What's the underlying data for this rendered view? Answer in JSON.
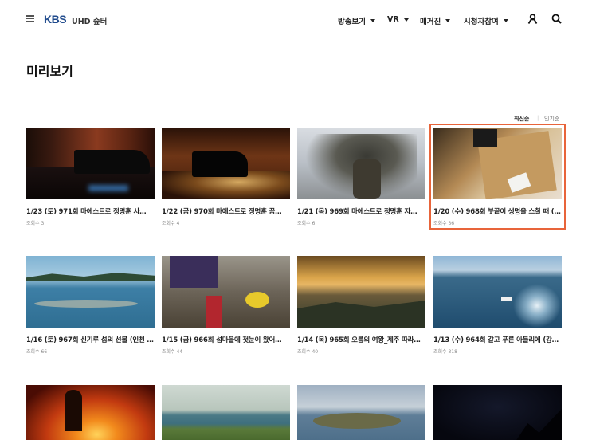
{
  "header": {
    "logo": "KBS",
    "subbrand": "UHD 숲터",
    "nav": [
      {
        "label": "방송보기"
      },
      {
        "label": "VR"
      },
      {
        "label": "매거진"
      },
      {
        "label": "시청자참여"
      }
    ],
    "icons": [
      "menu-icon",
      "user-icon",
      "search-icon"
    ]
  },
  "page": {
    "title": "미리보기"
  },
  "sort": {
    "latest": "최신순",
    "separator": "|",
    "popular": "인기순"
  },
  "accent_color": "#e8643a",
  "brand_color": "#1f4a8c",
  "videos": [
    {
      "title": "1/23 (토) 971회 마에스트로 정명훈 사…",
      "views": "조회수 3"
    },
    {
      "title": "1/22 (금) 970회 마에스트로 정명훈 꿈…",
      "views": "조회수 4"
    },
    {
      "title": "1/21 (목) 969회 마에스트로 정명훈 자…",
      "views": "조회수 6"
    },
    {
      "title": "1/20 (수) 968회 붓끝이 생명을 스칠 때 (…",
      "views": "조회수 36"
    },
    {
      "title": "1/16 (토) 967회 신기루 섬의 선물 (인천 …",
      "views": "조회수 66"
    },
    {
      "title": "1/15 (금) 966회 섬마을에 첫눈이 왔어…",
      "views": "조회수 44"
    },
    {
      "title": "1/14 (목) 965회 오름의 여왕_제주 따라…",
      "views": "조회수 40"
    },
    {
      "title": "1/13 (수) 964회 갈고 푸른 아들리에 (강…",
      "views": "조회수 318"
    },
    {
      "title": "",
      "views": ""
    },
    {
      "title": "",
      "views": ""
    },
    {
      "title": "",
      "views": ""
    },
    {
      "title": "",
      "views": ""
    }
  ]
}
